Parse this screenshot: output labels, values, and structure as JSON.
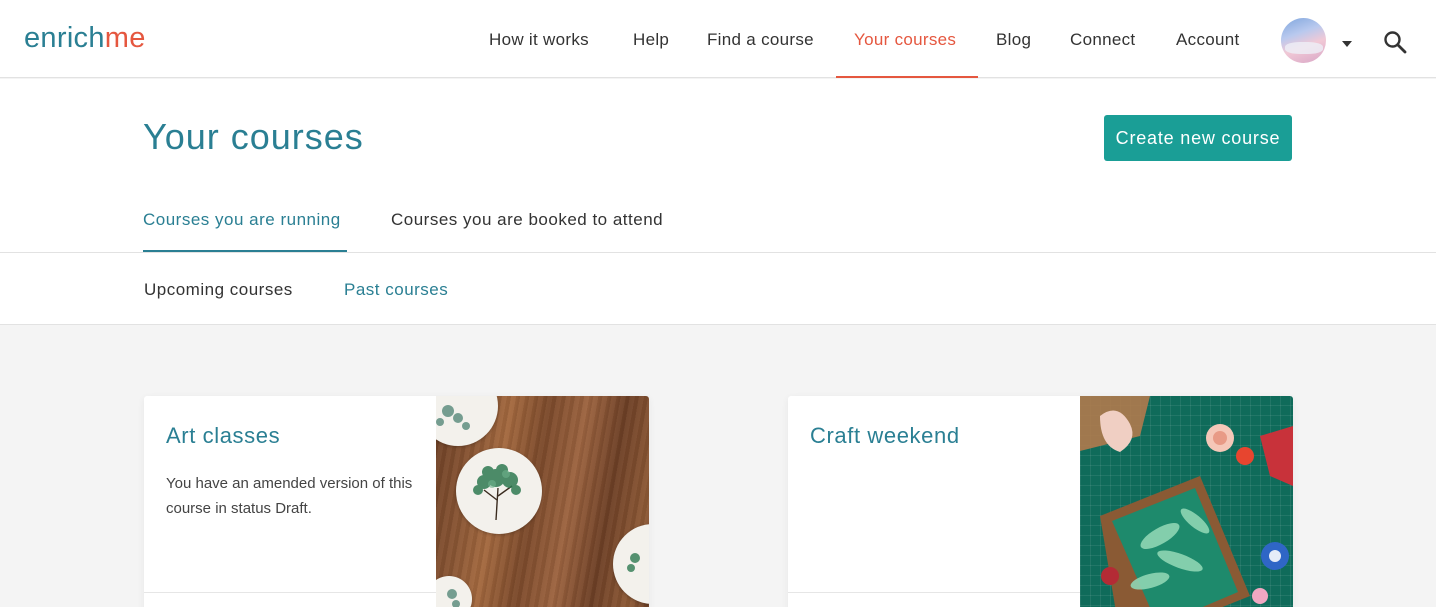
{
  "logo": {
    "part1": "enrich",
    "part2": "me"
  },
  "nav": {
    "items": [
      {
        "label": "How it works"
      },
      {
        "label": "Help"
      },
      {
        "label": "Find a course"
      },
      {
        "label": "Your courses",
        "active": true
      },
      {
        "label": "Blog"
      },
      {
        "label": "Connect"
      },
      {
        "label": "Account"
      }
    ],
    "icons": {
      "avatar": "user-avatar",
      "dropdown": "caret-down-icon",
      "search": "search-icon"
    }
  },
  "page": {
    "title": "Your courses",
    "create_button": "Create new course"
  },
  "tabs": [
    {
      "label": "Courses you are running",
      "active": true
    },
    {
      "label": "Courses you are booked to attend"
    }
  ],
  "subtabs": [
    {
      "label": "Upcoming courses"
    },
    {
      "label": "Past courses",
      "active": true
    }
  ],
  "courses": [
    {
      "title": "Art classes",
      "description": "You have an amended version of this course in status Draft.",
      "image": "painted-tree-coasters-on-wood"
    },
    {
      "title": "Craft weekend",
      "description": "",
      "image": "paper-craft-flowers-on-cutting-mat"
    }
  ],
  "colors": {
    "brand_teal": "#2a7f93",
    "accent_orange": "#e5573f",
    "button_teal": "#1a9e96"
  }
}
